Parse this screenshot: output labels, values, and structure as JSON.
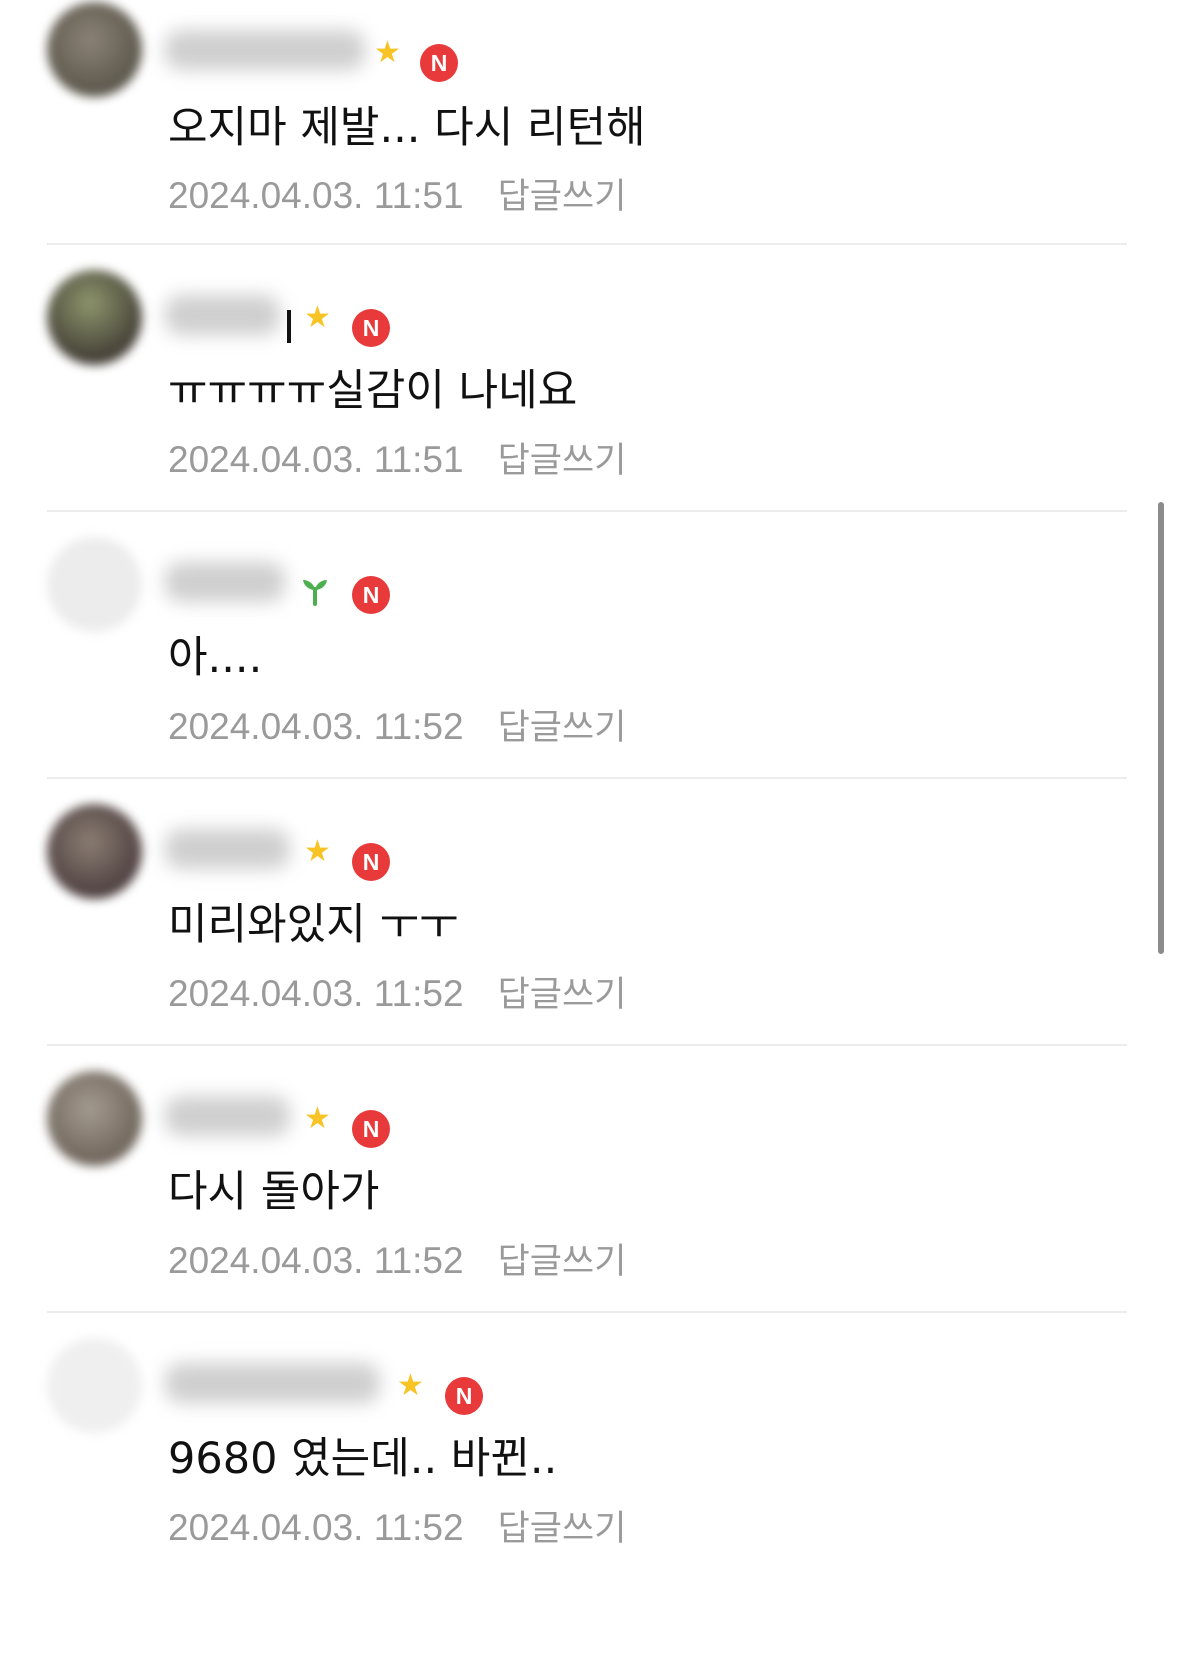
{
  "comments": [
    {
      "text": "오지마 제발... 다시 리턴해",
      "timestamp": "2024.04.03. 11:51",
      "reply_label": "답글쓰기",
      "badge_icon": "star-icon",
      "new_label": "N",
      "avatar_color": "#6f6a5e"
    },
    {
      "text": "ㅠㅠㅠㅠ실감이 나네요",
      "timestamp": "2024.04.03. 11:51",
      "reply_label": "답글쓰기",
      "badge_icon": "star-icon",
      "new_label": "N",
      "avatar_color": "#5d6445"
    },
    {
      "text": "아....",
      "timestamp": "2024.04.03. 11:52",
      "reply_label": "답글쓰기",
      "badge_icon": "sprout-icon",
      "new_label": "N",
      "avatar_color": "#ececec"
    },
    {
      "text": "미리와있지 ㅜㅜ",
      "timestamp": "2024.04.03. 11:52",
      "reply_label": "답글쓰기",
      "badge_icon": "star-icon",
      "new_label": "N",
      "avatar_color": "#6b5b55"
    },
    {
      "text": "다시 돌아가",
      "timestamp": "2024.04.03. 11:52",
      "reply_label": "답글쓰기",
      "badge_icon": "star-icon",
      "new_label": "N",
      "avatar_color": "#867c74"
    },
    {
      "text": "9680 였는데.. 바뀐..",
      "timestamp": "2024.04.03. 11:52",
      "reply_label": "답글쓰기",
      "badge_icon": "star-icon",
      "new_label": "N",
      "avatar_color": "#efefef"
    }
  ],
  "colors": {
    "new_badge": "#e83a3a",
    "star": "#f7c325",
    "sprout": "#4caf50",
    "meta_text": "#9a9a9a",
    "divider": "#ececec"
  }
}
